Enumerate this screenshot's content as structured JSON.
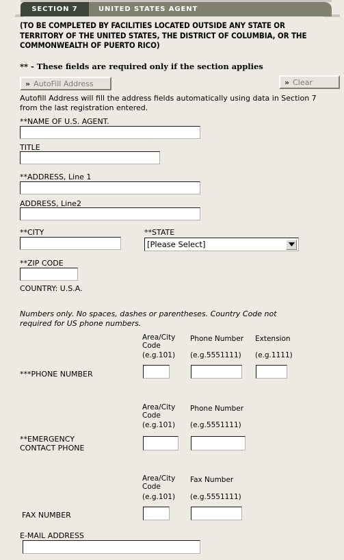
{
  "tab": {
    "section_label": "SECTION  7",
    "title": "UNITED STATES AGENT"
  },
  "notes": {
    "completed_by": "(TO BE COMPLETED BY FACILITIES LOCATED OUTSIDE ANY STATE OR TERRITORY OF THE UNITED STATES, THE DISTRICT OF COLUMBIA, OR THE COMMONWEALTH OF PUERTO RICO)",
    "required_legend": "** - These fields are required only if the section applies",
    "autofill_description": "Autofill Address will fill the address fields automatically using data in Section 7 from the last registration entered.",
    "phone_format": "Numbers only. No spaces, dashes or parentheses. Country Code not required for US phone numbers."
  },
  "buttons": {
    "autofill": {
      "chevron": "»",
      "label": "AutoFill Address"
    },
    "clear": {
      "chevron": "»",
      "label": "Clear"
    }
  },
  "fields": {
    "agent_name": {
      "label": "**NAME OF U.S. AGENT.",
      "value": ""
    },
    "title": {
      "label": "TITLE",
      "value": ""
    },
    "address1": {
      "label": "**ADDRESS, Line 1",
      "value": ""
    },
    "address2": {
      "label": "ADDRESS, Line2",
      "value": ""
    },
    "city": {
      "label": "**CITY",
      "value": ""
    },
    "state": {
      "label": "**STATE",
      "selected": "[Please Select]"
    },
    "zip": {
      "label": "**ZIP CODE",
      "value": ""
    },
    "country": {
      "label": "COUNTRY: U.S.A."
    },
    "email": {
      "label": "E-MAIL ADDRESS",
      "value": ""
    }
  },
  "phone_rows": {
    "phone": {
      "label": "***PHONE NUMBER",
      "col_area": "Area/City\nCode",
      "col_number": "Phone Number",
      "col_ext": "Extension",
      "eg_area": "(e.g.101)",
      "eg_number": "(e.g.5551111)",
      "eg_ext": "(e.g.1111)",
      "area_value": "",
      "number_value": "",
      "ext_value": ""
    },
    "emergency": {
      "label": "**EMERGENCY\nCONTACT PHONE",
      "col_area": "Area/City\nCode",
      "col_number": "Phone Number",
      "eg_area": "(e.g.101)",
      "eg_number": "(e.g.5551111)",
      "area_value": "",
      "number_value": ""
    },
    "fax": {
      "label": "FAX NUMBER",
      "col_area": "Area/City\nCode",
      "col_number": "Fax Number",
      "eg_area": "(e.g.101)",
      "eg_number": "(e.g.5551111)",
      "area_value": "",
      "number_value": ""
    }
  },
  "colors": {
    "page_background": "#edeae4",
    "tab_section": "#3d4438",
    "tab_title": "#80806f"
  }
}
